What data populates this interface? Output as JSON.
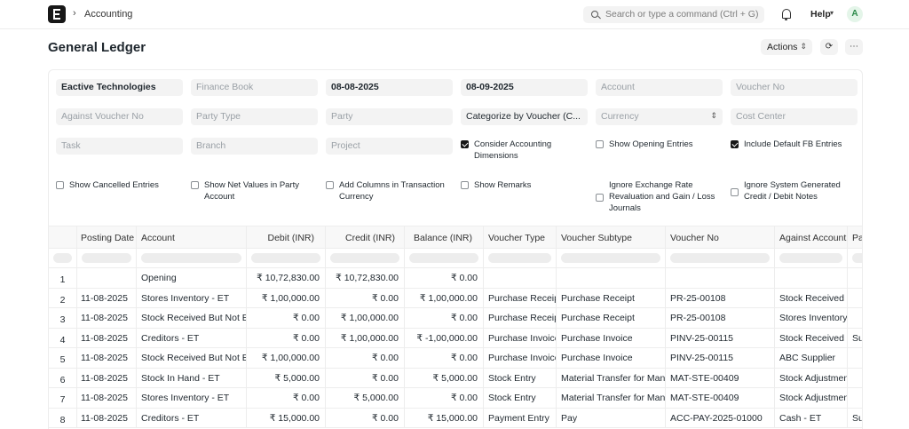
{
  "navbar": {
    "breadcrumb": "Accounting",
    "search_placeholder": "Search or type a command (Ctrl + G)",
    "help_label": "Help",
    "avatar_initial": "A"
  },
  "page": {
    "title": "General Ledger",
    "actions_label": "Actions"
  },
  "filters": {
    "company": "Eactive Technologies",
    "finance_book": "Finance Book",
    "from_date": "08-08-2025",
    "to_date": "08-09-2025",
    "account": "Account",
    "voucher_no": "Voucher No",
    "against_voucher_no": "Against Voucher No",
    "party_type": "Party Type",
    "party": "Party",
    "group_by": "Categorize by Voucher (C...",
    "currency": "Currency",
    "cost_center": "Cost Center",
    "task": "Task",
    "branch": "Branch",
    "project": "Project"
  },
  "checks": [
    {
      "label": "Consider Accounting Dimensions",
      "checked": true
    },
    {
      "label": "Show Opening Entries",
      "checked": false
    },
    {
      "label": "Include Default FB Entries",
      "checked": true
    },
    {
      "label": "Show Cancelled Entries",
      "checked": false
    },
    {
      "label": "Show Net Values in Party Account",
      "checked": false
    },
    {
      "label": "Add Columns in Transaction Currency",
      "checked": false
    },
    {
      "label": "Show Remarks",
      "checked": false
    },
    {
      "label": "Ignore Exchange Rate Revaluation and Gain / Loss Journals",
      "checked": false
    },
    {
      "label": "Ignore System Generated Credit / Debit Notes",
      "checked": false
    }
  ],
  "table": {
    "columns": [
      "Posting Date",
      "Account",
      "Debit (INR)",
      "Credit (INR)",
      "Balance (INR)",
      "Voucher Type",
      "Voucher Subtype",
      "Voucher No",
      "Against Account",
      "Party"
    ],
    "rows": [
      [
        "1",
        "",
        "Opening",
        "₹ 10,72,830.00",
        "₹ 10,72,830.00",
        "₹ 0.00",
        "",
        "",
        "",
        "",
        ""
      ],
      [
        "2",
        "11-08-2025",
        "Stores Inventory - ET",
        "₹ 1,00,000.00",
        "₹ 0.00",
        "₹ 1,00,000.00",
        "Purchase Receipt",
        "Purchase Receipt",
        "PR-25-00108",
        "Stock Received But Not Billed - ET",
        ""
      ],
      [
        "3",
        "11-08-2025",
        "Stock Received But Not Billed - ET",
        "₹ 0.00",
        "₹ 1,00,000.00",
        "₹ 0.00",
        "Purchase Receipt",
        "Purchase Receipt",
        "PR-25-00108",
        "Stores Inventory - ET",
        ""
      ],
      [
        "4",
        "11-08-2025",
        "Creditors - ET",
        "₹ 0.00",
        "₹ 1,00,000.00",
        "₹ -1,00,000.00",
        "Purchase Invoice",
        "Purchase Invoice",
        "PINV-25-00115",
        "Stock Received But Not Billed - ET",
        "Supplier"
      ],
      [
        "5",
        "11-08-2025",
        "Stock Received But Not Billed - ET",
        "₹ 1,00,000.00",
        "₹ 0.00",
        "₹ 0.00",
        "Purchase Invoice",
        "Purchase Invoice",
        "PINV-25-00115",
        "ABC Supplier",
        ""
      ],
      [
        "6",
        "11-08-2025",
        "Stock In Hand - ET",
        "₹ 5,000.00",
        "₹ 0.00",
        "₹ 5,000.00",
        "Stock Entry",
        "Material Transfer for Manufacture",
        "MAT-STE-00409",
        "Stock Adjustment - ET",
        ""
      ],
      [
        "7",
        "11-08-2025",
        "Stores Inventory - ET",
        "₹ 0.00",
        "₹ 5,000.00",
        "₹ 0.00",
        "Stock Entry",
        "Material Transfer for Manufacture",
        "MAT-STE-00409",
        "Stock Adjustment - ET",
        ""
      ],
      [
        "8",
        "11-08-2025",
        "Creditors - ET",
        "₹ 15,000.00",
        "₹ 0.00",
        "₹ 15,000.00",
        "Payment Entry",
        "Pay",
        "ACC-PAY-2025-01000",
        "Cash - ET",
        "Supplier"
      ]
    ]
  }
}
